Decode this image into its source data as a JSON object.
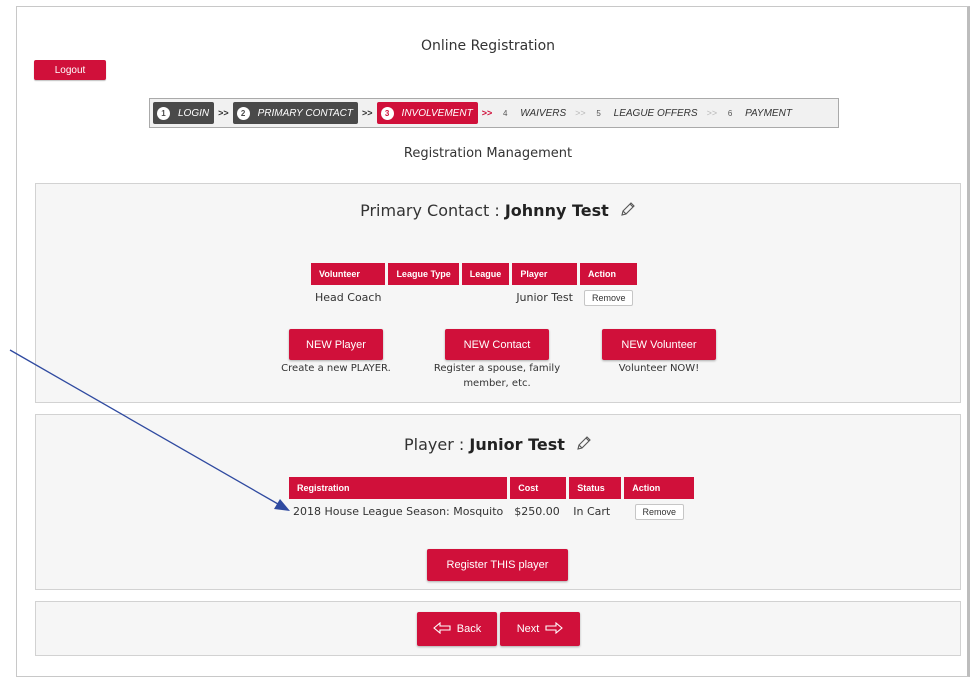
{
  "app": {
    "title": "Online Registration",
    "logout_label": "Logout"
  },
  "steps": [
    {
      "num": "1",
      "label": "LOGIN",
      "state": "done"
    },
    {
      "num": "2",
      "label": "PRIMARY CONTACT",
      "state": "done"
    },
    {
      "num": "3",
      "label": "INVOLVEMENT",
      "state": "current"
    },
    {
      "num": "4",
      "label": "WAIVERS",
      "state": "todo"
    },
    {
      "num": "5",
      "label": "LEAGUE OFFERS",
      "state": "todo"
    },
    {
      "num": "6",
      "label": "PAYMENT",
      "state": "todo"
    }
  ],
  "step_separator": ">>",
  "page_subtitle": "Registration Management",
  "contact_panel": {
    "heading_prefix": "Primary Contact : ",
    "heading_name": "Johnny Test",
    "table": {
      "headers": [
        "Volunteer",
        "League Type",
        "League",
        "Player",
        "Action"
      ],
      "row": {
        "volunteer": "Head Coach",
        "league_type": "",
        "league": "",
        "player": "Junior Test",
        "action": "Remove"
      }
    },
    "new_player_label": "NEW Player",
    "new_player_help": "Create a new PLAYER.",
    "new_contact_label": "NEW Contact",
    "new_contact_help": "Register a spouse, family member, etc.",
    "new_volunteer_label": "NEW Volunteer",
    "new_volunteer_help": "Volunteer NOW!"
  },
  "player_panel": {
    "heading_prefix": "Player : ",
    "heading_name": "Junior Test",
    "table": {
      "headers": [
        "Registration",
        "Cost",
        "Status",
        "Action"
      ],
      "row": {
        "registration": "2018 House League Season: Mosquito",
        "cost": "$250.00",
        "status": "In Cart",
        "action": "Remove"
      }
    },
    "register_label": "Register THIS player"
  },
  "nav": {
    "back_label": "Back",
    "next_label": "Next"
  },
  "colors": {
    "accent": "#d0103a",
    "dark_step": "#4a4a4a",
    "annotation_arrow": "#2f4aa0"
  }
}
